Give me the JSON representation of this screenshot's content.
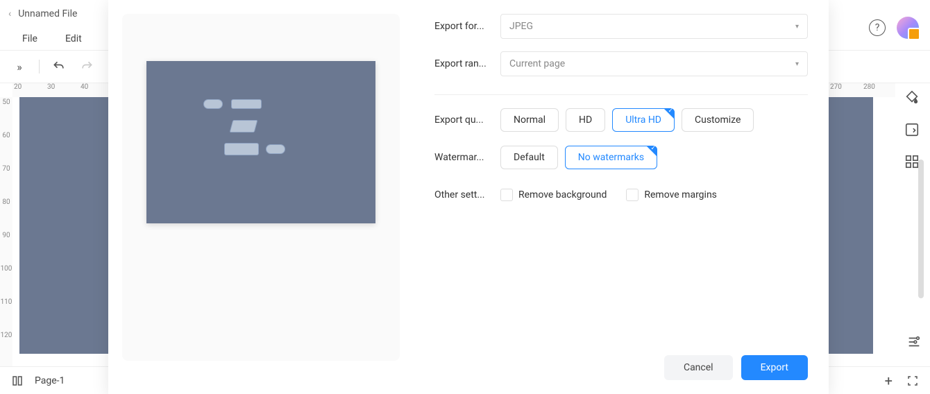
{
  "title_bar": {
    "filename": "Unnamed File"
  },
  "menu_bar": {
    "file": "File",
    "edit": "Edit"
  },
  "ruler_h": [
    "20",
    "30",
    "40",
    "270",
    "280"
  ],
  "ruler_v": [
    "50",
    "60",
    "70",
    "80",
    "90",
    "100",
    "110",
    "120"
  ],
  "status_bar": {
    "page": "Page-1"
  },
  "dialog": {
    "labels": {
      "format": "Export for...",
      "range": "Export ran...",
      "quality": "Export qu...",
      "watermark": "Watermar...",
      "other": "Other sett..."
    },
    "format_value": "JPEG",
    "range_value": "Current page",
    "quality_options": {
      "normal": "Normal",
      "hd": "HD",
      "ultra": "Ultra HD",
      "customize": "Customize"
    },
    "watermark_options": {
      "default": "Default",
      "none": "No watermarks"
    },
    "other_options": {
      "remove_bg": "Remove background",
      "remove_margins": "Remove margins"
    },
    "buttons": {
      "cancel": "Cancel",
      "export": "Export"
    }
  }
}
